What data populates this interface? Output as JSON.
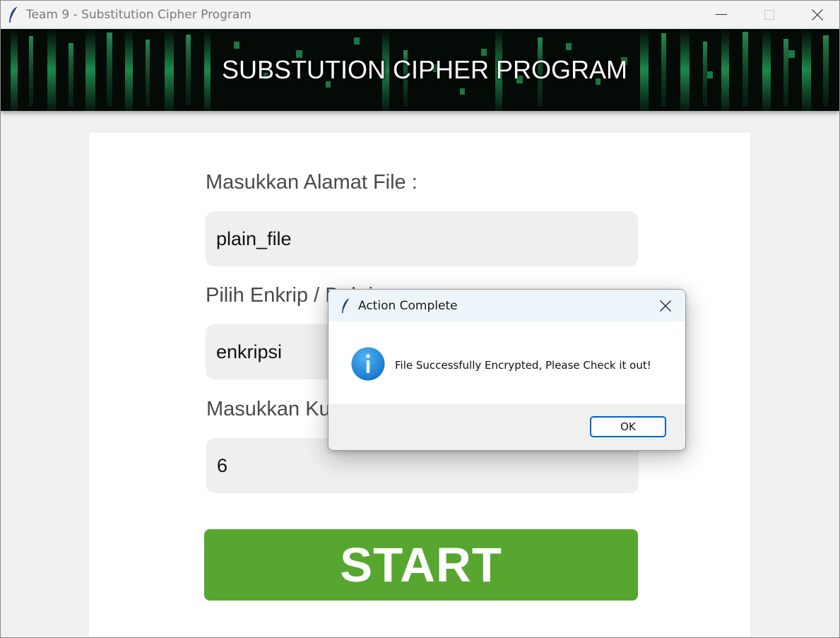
{
  "window": {
    "title": "Team 9 - Substitution Cipher Program",
    "app_icon": "feather-icon",
    "controls": [
      "minimize-icon",
      "maximize-icon",
      "close-icon"
    ]
  },
  "banner": {
    "title": "SUBSTUTION CIPHER PROGRAM",
    "background": "matrix-code-image"
  },
  "form": {
    "file_label": "Masukkan Alamat File :",
    "file_value": "plain_file",
    "mode_label": "Pilih Enkrip / Dekrip :",
    "mode_value": "enkripsi",
    "key_label": "Masukkan Kunci :",
    "key_value": "6",
    "start_label": "START"
  },
  "dialog": {
    "title": "Action Complete",
    "icon": "info-icon",
    "message": "File Successfully Encrypted, Please Check it out!",
    "ok_label": "OK"
  },
  "colors": {
    "start_button": "#57a62f",
    "ok_border": "#0067c0",
    "info_icon": "#1a82d4",
    "banner_text": "#ffffff"
  }
}
